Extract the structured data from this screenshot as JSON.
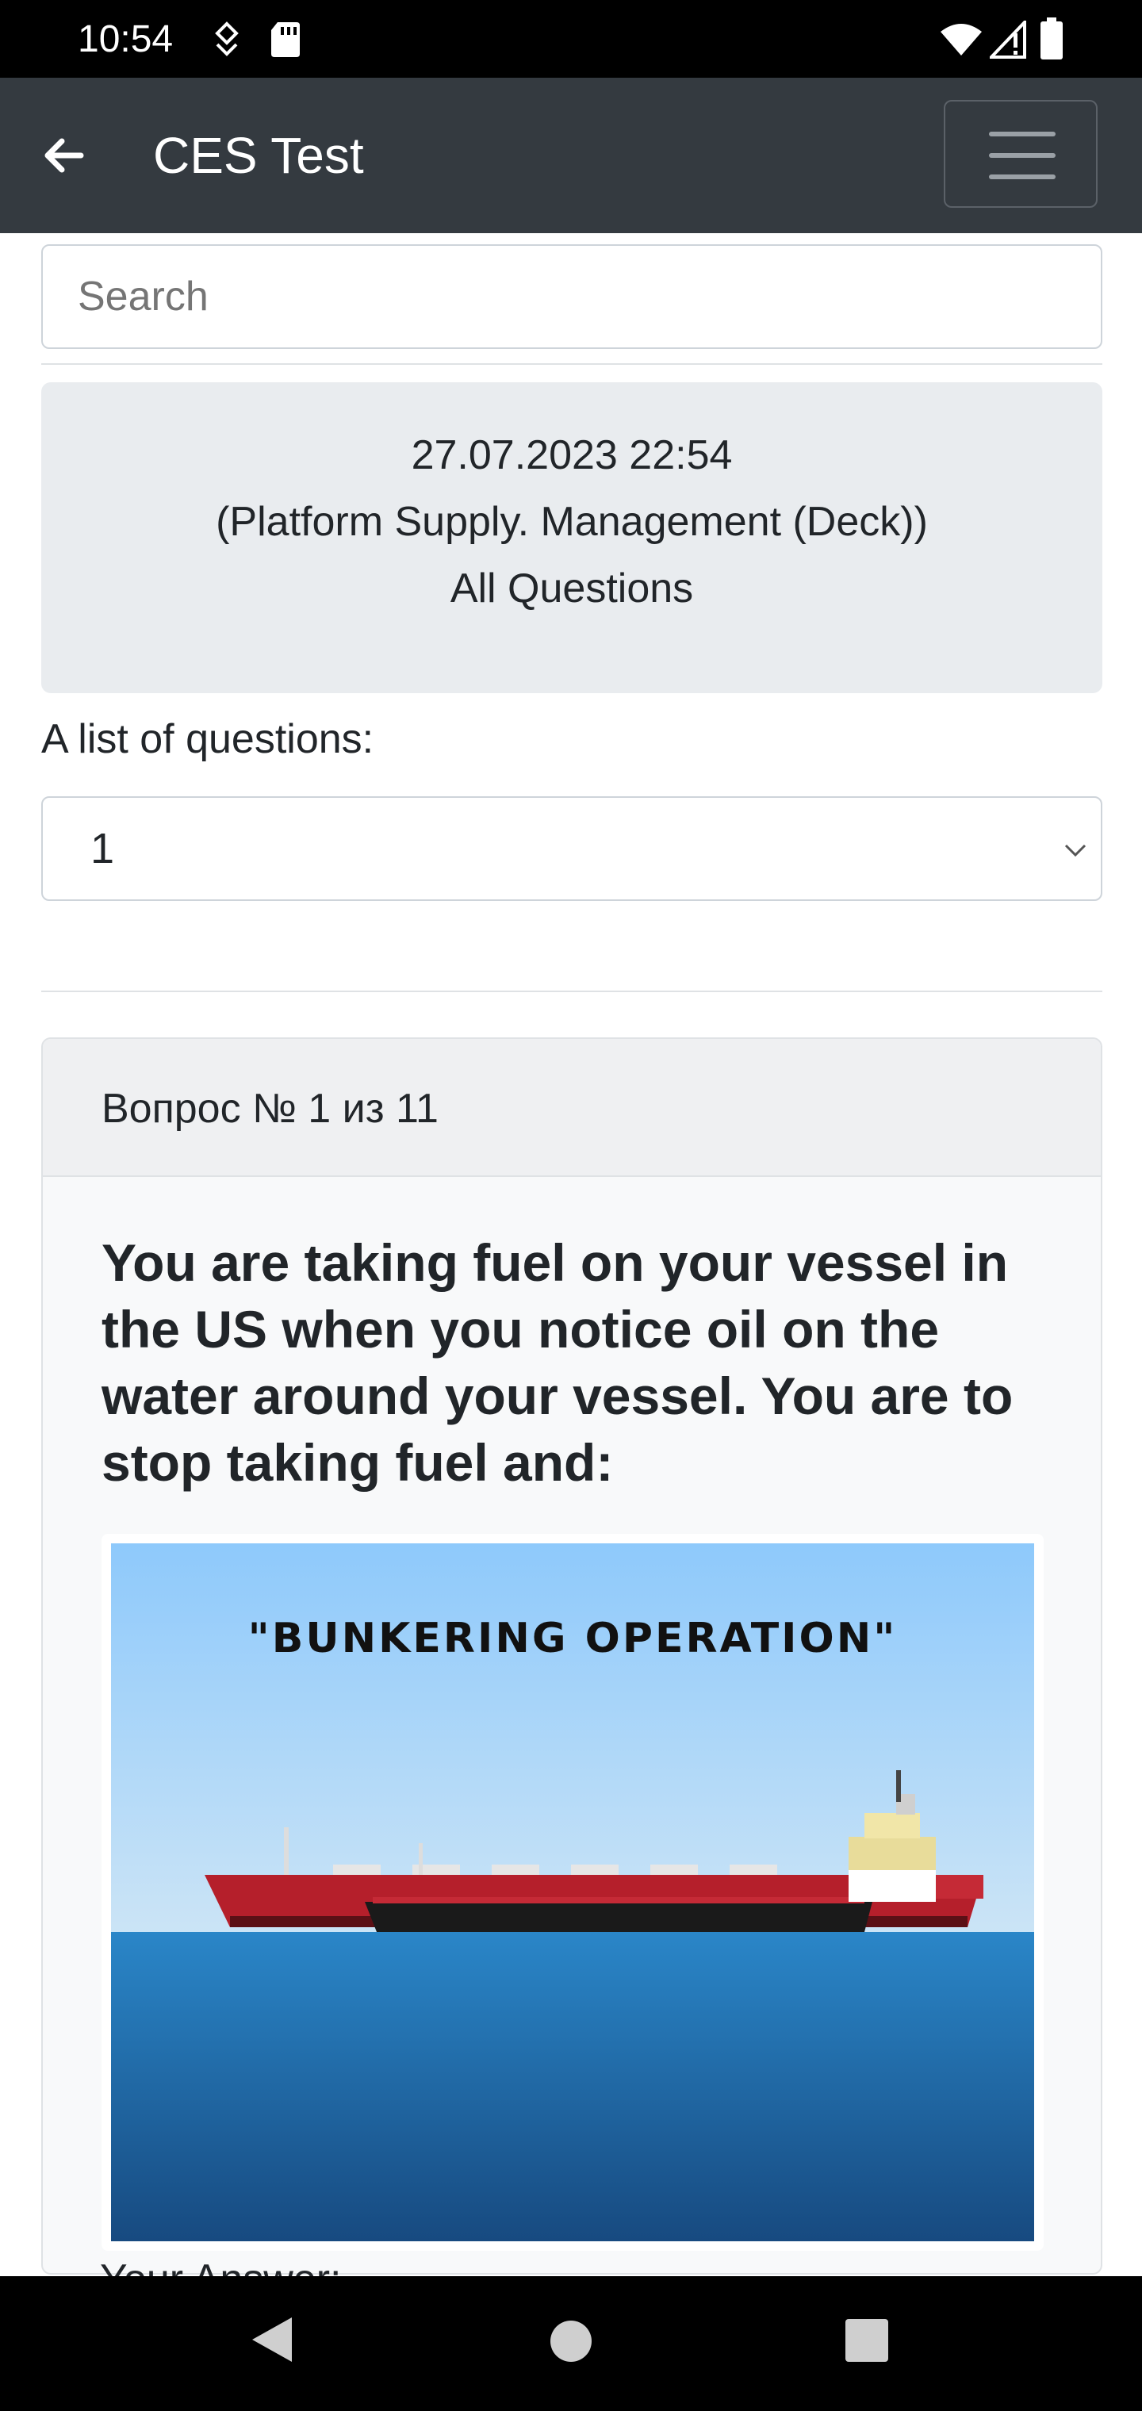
{
  "status_bar": {
    "time": "10:54"
  },
  "app_bar": {
    "title": "CES Test"
  },
  "search": {
    "placeholder": "Search"
  },
  "info": {
    "datetime": "27.07.2023 22:54",
    "course": "(Platform Supply. Management (Deck))",
    "scope": "All Questions"
  },
  "questions_list": {
    "label": "A list of questions:",
    "selected": "1"
  },
  "question": {
    "header": "Вопрос № 1 из 11",
    "text": "You are taking fuel on your vessel in the US when you notice oil on the water around your vessel. You are to stop taking fuel and:",
    "image_caption": "\"BUNKERING OPERATION\"",
    "answer_label": "Your Answer:"
  }
}
